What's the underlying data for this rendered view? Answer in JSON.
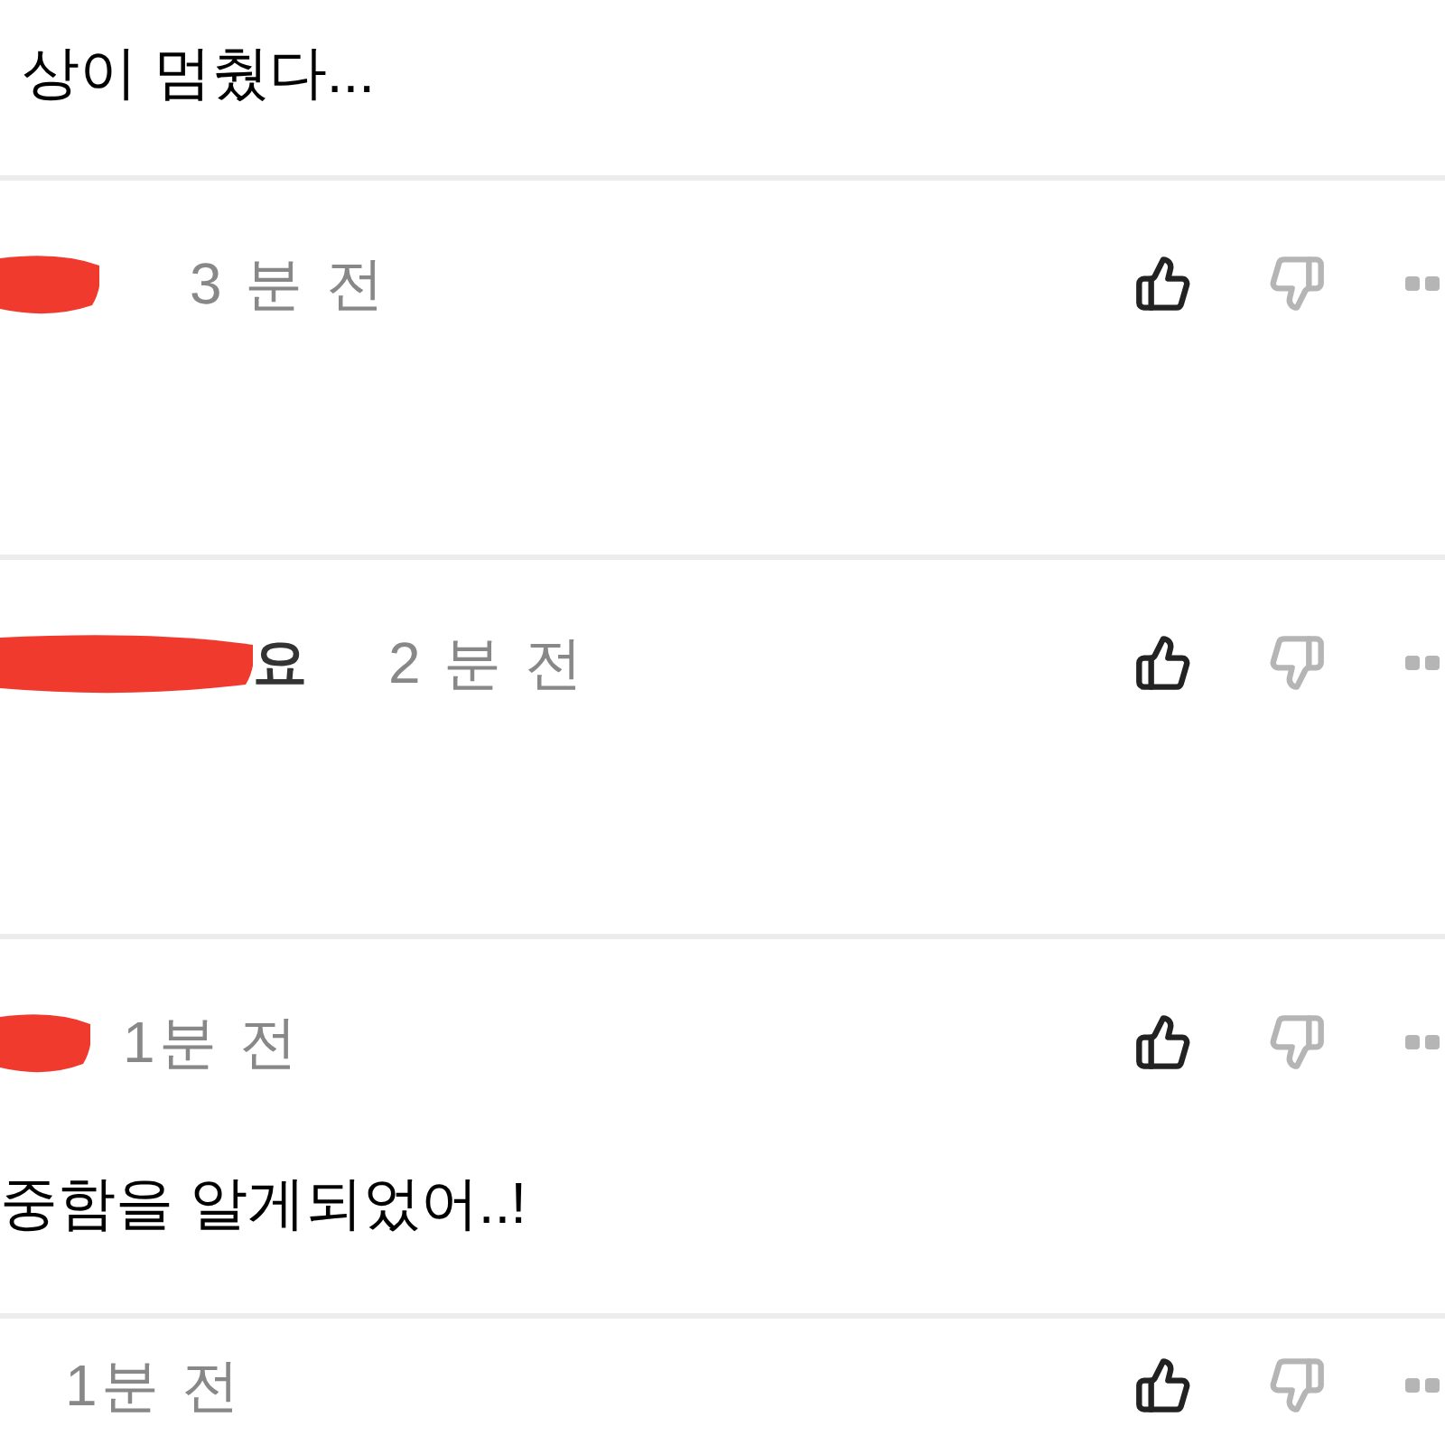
{
  "post_tail": "상이 멈췄다...",
  "comments": [
    {
      "author_redacted": true,
      "time": "3 분 전"
    },
    {
      "author_redacted": true,
      "author": "요",
      "time": "2 분 전"
    },
    {
      "author_redacted": true,
      "time": "1분 전",
      "body": "중함을 알게되었어..!"
    },
    {
      "author_redacted": false,
      "time": "1분 전"
    }
  ]
}
